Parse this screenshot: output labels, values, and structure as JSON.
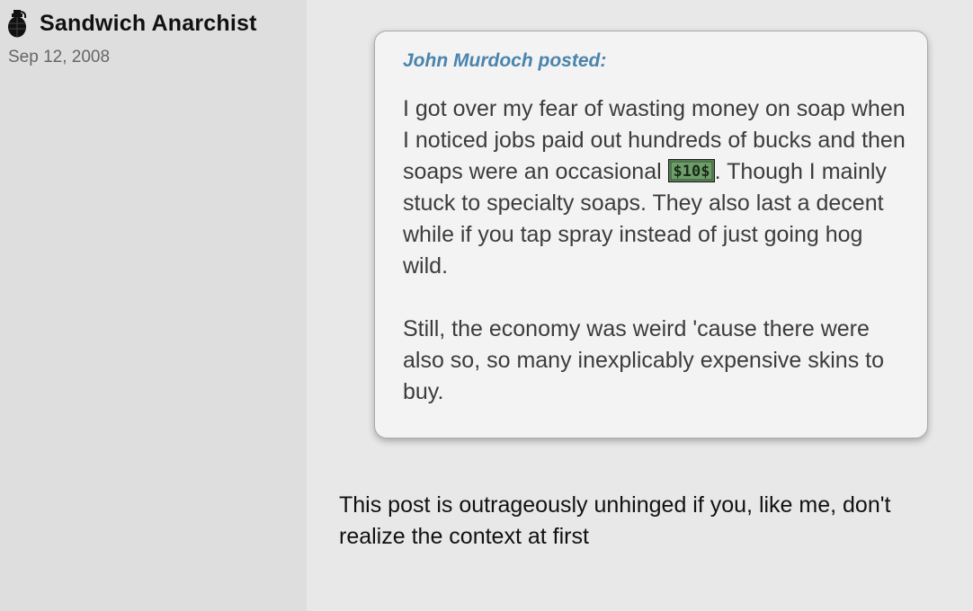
{
  "author": {
    "username": "Sandwich Anarchist",
    "registration_date": "Sep 12, 2008",
    "avatar_icon": "grenade-icon"
  },
  "quote": {
    "attribution": "John Murdoch posted:",
    "paragraph1_before_emote": "I got over my fear of wasting money on soap when I noticed jobs paid out hundreds of bucks and then soaps were an occasional ",
    "emote_label": "$10$",
    "emote_icon": "ten-dollar-emote-icon",
    "paragraph1_after_emote": ". Though I mainly stuck to specialty soaps. They also last a decent while if you tap spray instead of just going hog wild.",
    "paragraph2": "Still, the economy was weird 'cause there were also so, so many inexplicably expensive skins to buy."
  },
  "post": {
    "body": "This post is outrageously unhinged if you, like me, don't realize the context at first"
  },
  "colors": {
    "sidebar_bg": "#dedede",
    "content_bg": "#e8e8e8",
    "quote_bg": "#f3f3f3",
    "quote_author": "#4a84ad",
    "emote_green": "#6e9e6a"
  }
}
